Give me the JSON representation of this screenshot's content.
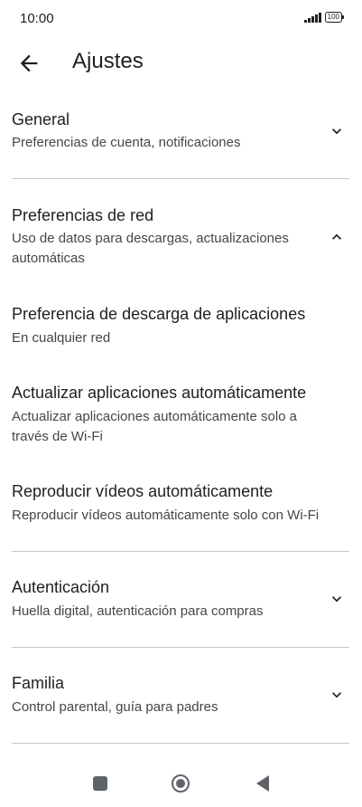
{
  "status_bar": {
    "time": "10:00",
    "battery": "100"
  },
  "header": {
    "title": "Ajustes",
    "back_icon": "arrow-back-icon"
  },
  "sections": {
    "general": {
      "title": "General",
      "subtitle": "Preferencias de cuenta, notificaciones",
      "expanded": false
    },
    "network": {
      "title": "Preferencias de red",
      "subtitle": "Uso de datos para descargas, actualizaciones automáticas",
      "expanded": true,
      "items": {
        "download": {
          "title": "Preferencia de descarga de aplicaciones",
          "subtitle": "En cualquier red"
        },
        "autoupdate": {
          "title": "Actualizar aplicaciones automáticamente",
          "subtitle": "Actualizar aplicaciones automáticamente solo a través de Wi-Fi"
        },
        "autoplay": {
          "title": "Reproducir vídeos automáticamente",
          "subtitle": "Reproducir vídeos automáticamente solo con Wi-Fi"
        }
      }
    },
    "auth": {
      "title": "Autenticación",
      "subtitle": "Huella digital, autenticación para compras",
      "expanded": false
    },
    "family": {
      "title": "Familia",
      "subtitle": "Control parental, guía para padres",
      "expanded": false
    }
  },
  "nav_bar": {
    "icons": [
      "recents-square-icon",
      "home-circle-icon",
      "back-triangle-icon"
    ]
  }
}
